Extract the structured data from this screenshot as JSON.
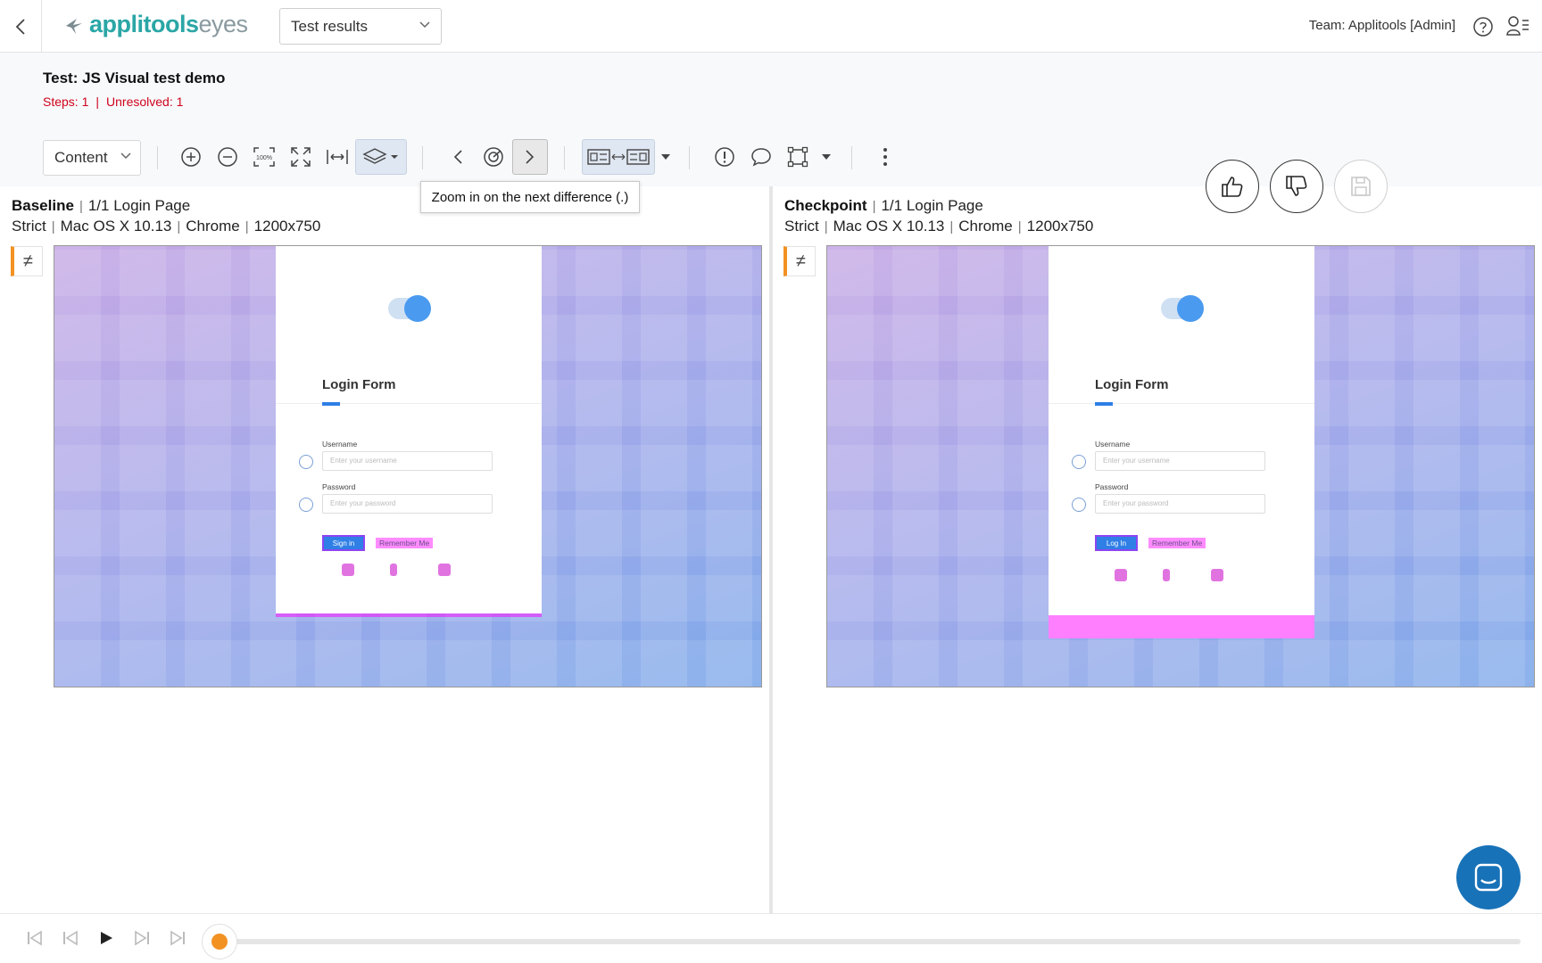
{
  "app": {
    "logo_name": "applitools",
    "logo_product": "eyes",
    "results_select": "Test results",
    "team": "Team: Applitools [Admin]"
  },
  "test": {
    "title": "Test: JS Visual test demo",
    "steps": "Steps: 1",
    "unresolved": "Unresolved: 1"
  },
  "toolbar": {
    "content_select": "Content",
    "tooltip": "Zoom in on the next difference (.)",
    "icons": [
      "zoom-in-icon",
      "zoom-out-icon",
      "actual-size-icon",
      "fit-screen-icon",
      "fit-width-icon",
      "layers-icon",
      "previous-difference-icon",
      "target-icon",
      "next-difference-icon",
      "side-by-side-icon",
      "issue-icon",
      "comment-icon",
      "region-icon",
      "more-icon"
    ],
    "zoom_100_label": "100%"
  },
  "panels": {
    "baseline": {
      "role": "Baseline",
      "step": "1/1 Login Page",
      "match_level": "Strict",
      "os": "Mac OS X 10.13",
      "browser": "Chrome",
      "viewport": "1200x750"
    },
    "checkpoint": {
      "role": "Checkpoint",
      "step": "1/1 Login Page",
      "match_level": "Strict",
      "os": "Mac OS X 10.13",
      "browser": "Chrome",
      "viewport": "1200x750"
    },
    "not_equal_symbol": "≠"
  },
  "screenshot": {
    "form_title": "Login Form",
    "username_label": "Username",
    "username_placeholder": "Enter your username",
    "password_label": "Password",
    "password_placeholder": "Enter your password",
    "baseline_button": "Sign in",
    "checkpoint_button": "Log In",
    "remember_baseline": "Remember Me",
    "remember_checkpoint": "Remember Me"
  },
  "playback": {
    "progress": 0
  },
  "colors": {
    "accent_teal": "#2ba6a6",
    "error_red": "#d0021b",
    "progress_orange": "#f29222",
    "chat_blue": "#1872b8",
    "diff_magenta": "#ff00ff"
  }
}
